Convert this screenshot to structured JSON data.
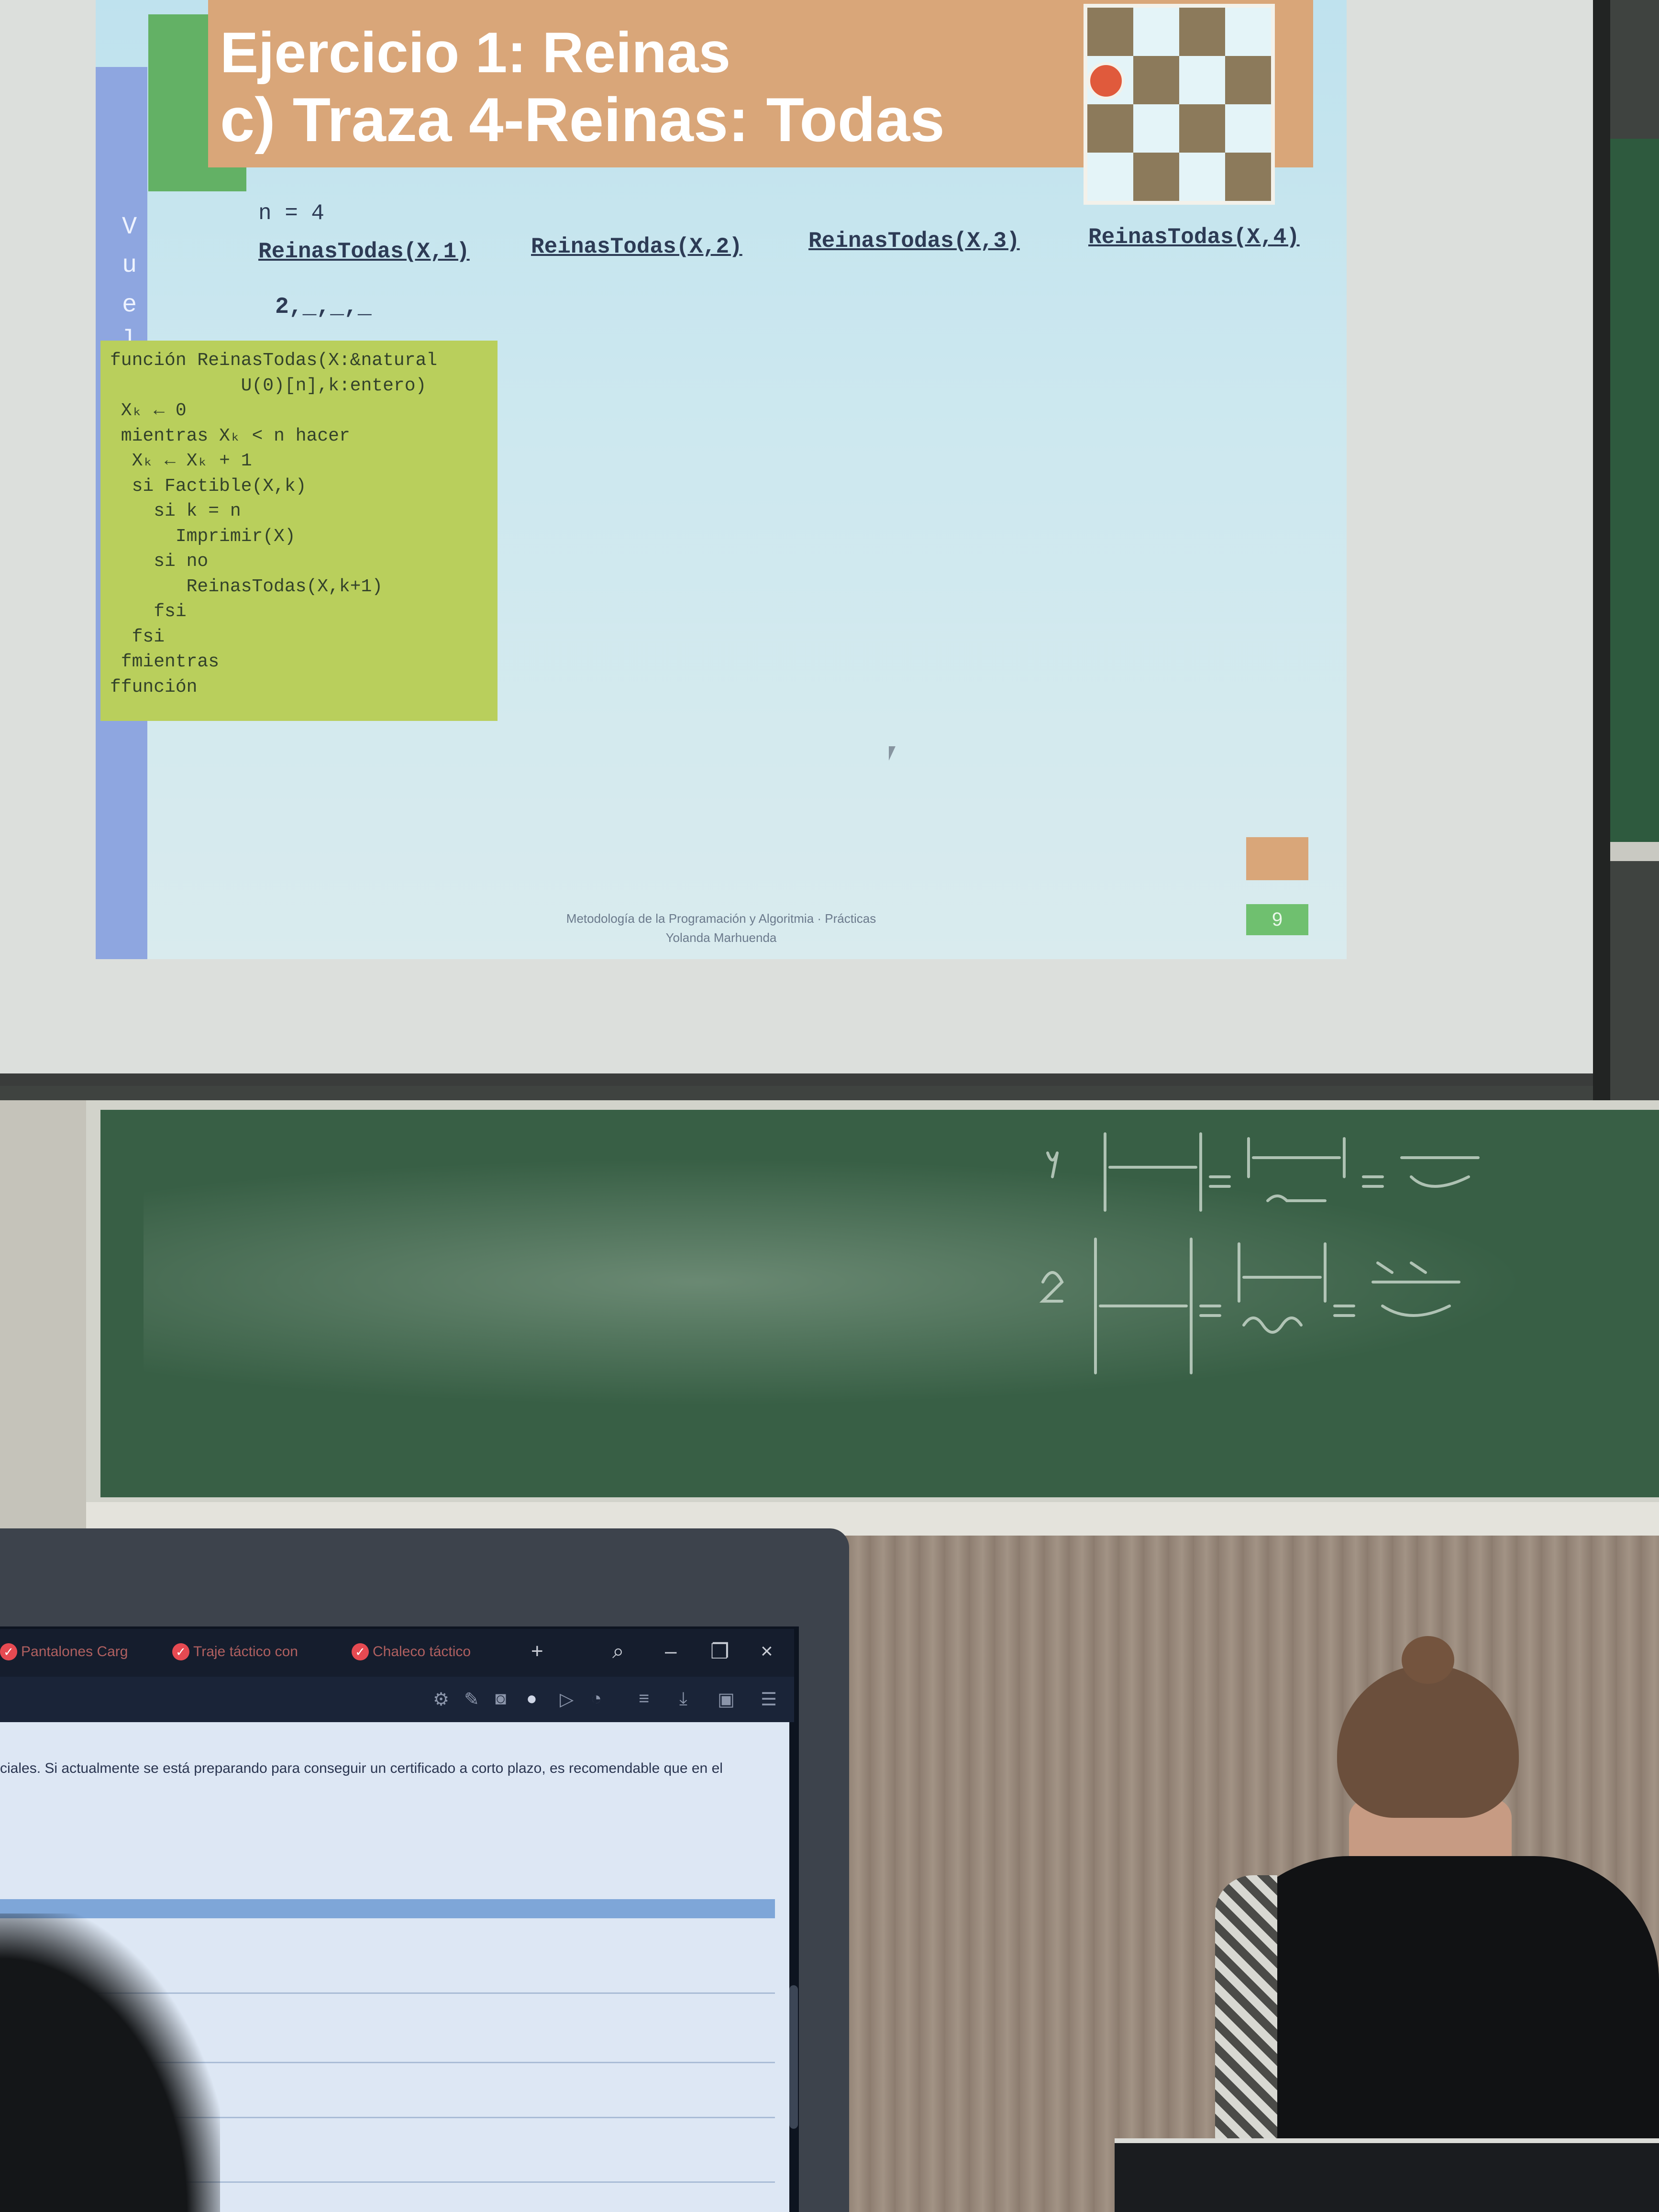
{
  "slide": {
    "title": "Ejercicio 1: Reinas",
    "subtitle": "c) Traza 4-Reinas: Todas",
    "side_letters": [
      "V",
      "u",
      "e",
      "l"
    ],
    "n_line": "n = 4",
    "trace_headers": [
      "ReinasTodas(X,1)",
      "ReinasTodas(X,2)",
      "ReinasTodas(X,3)",
      "ReinasTodas(X,4)"
    ],
    "trace_value": "2,_,_,_",
    "code_lines": [
      "función ReinasTodas(X:&natural",
      "            U(0)[n],k:entero)",
      " Xₖ ← 0",
      " mientras Xₖ < n hacer",
      "  Xₖ ← Xₖ + 1",
      "  si Factible(X,k)",
      "    si k = n",
      "      Imprimir(X)",
      "    si no",
      "       ReinasTodas(X,k+1)",
      "    fsi",
      "  fsi",
      " fmientras",
      "ffunción"
    ],
    "footer_line1": "Metodología de la Programación y Algoritmia · Prácticas",
    "footer_line2": "Yolanda Marhuenda",
    "page_number": "9",
    "colors": {
      "title_bar": "#d9a679",
      "green_accent": "#63b165",
      "side_bar": "#8ea6e0",
      "code_box": "#b9cf5c",
      "background": "#c6e5ef"
    }
  },
  "laptop": {
    "tabs": [
      {
        "label": "Pantalones Carg",
        "icon": "check-shield-icon"
      },
      {
        "label": "Traje táctico con",
        "icon": "check-shield-icon"
      },
      {
        "label": "Chaleco táctico",
        "icon": "check-shield-icon"
      }
    ],
    "window_controls": [
      "+",
      "search-icon",
      "–",
      "restore-icon",
      "×"
    ],
    "page_text": "ciales. Si actualmente se está preparando para conseguir un certificado a corto plazo, es recomendable que en el"
  }
}
